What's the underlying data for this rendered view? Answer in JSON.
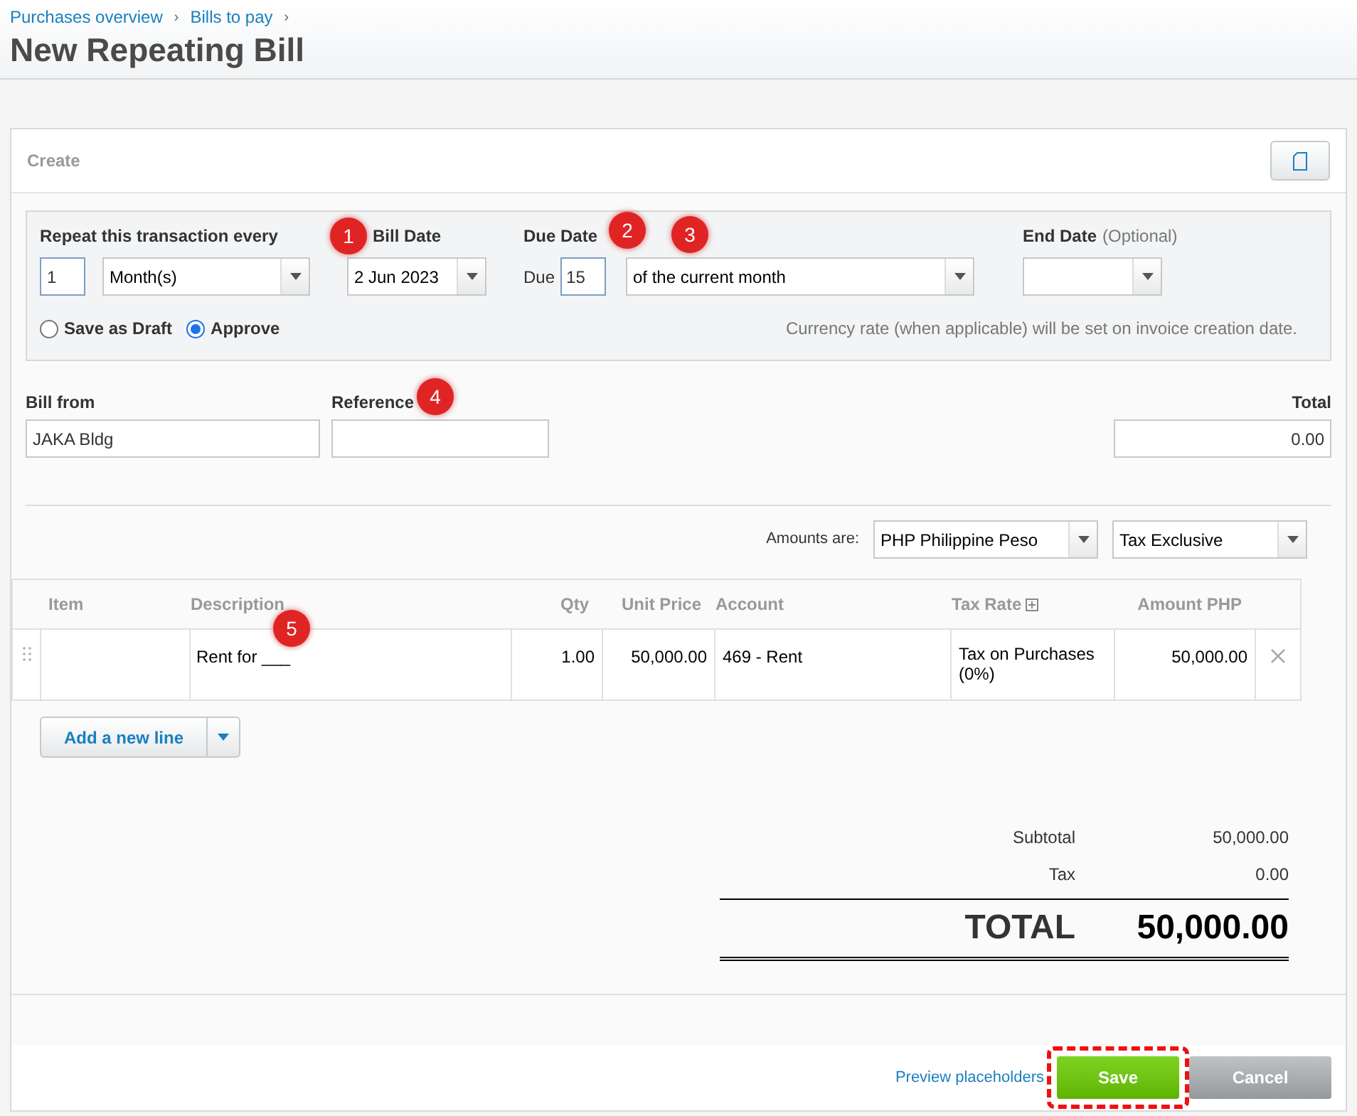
{
  "breadcrumbs": [
    {
      "label": "Purchases overview",
      "separator": "›"
    },
    {
      "label": "Bills to pay",
      "separator": "›"
    }
  ],
  "title": "New Repeating Bill",
  "panel": {
    "title": "Create"
  },
  "schedule": {
    "repeat_label": "Repeat this transaction every",
    "repeat_every": "1",
    "period": "Month(s)",
    "bill_date_label": "Bill Date",
    "bill_date_marker": "1",
    "bill_date": "2 Jun 2023",
    "due_date_label": "Due Date",
    "due_prefix": "Due",
    "due_day_marker": "2",
    "due_day": "15",
    "due_option_marker": "3",
    "due_option": "of the current month",
    "end_date_label": "End Date",
    "end_date_hint": "(Optional)",
    "status_options": [
      {
        "label": "Save as Draft",
        "selected": false
      },
      {
        "label": "Approve",
        "selected": true
      }
    ],
    "note": "Currency rate (when applicable) will be set on invoice creation date."
  },
  "bill_from": {
    "label": "Bill from",
    "value": "JAKA Bldg"
  },
  "reference": {
    "label": "Reference",
    "marker": "4"
  },
  "total_field": {
    "label": "Total",
    "value": "0.00"
  },
  "amounts": {
    "label": "Amounts are:",
    "currency": "PHP Philippine Peso",
    "tax_mode": "Tax Exclusive"
  },
  "table": {
    "columns": [
      {
        "label": "Item",
        "expandable": false
      },
      {
        "label": "Description",
        "expandable": false
      },
      {
        "label": "Qty",
        "expandable": false
      },
      {
        "label": "Unit Price",
        "expandable": false
      },
      {
        "label": "Account",
        "expandable": false
      },
      {
        "label": "Tax Rate",
        "expandable": true
      },
      {
        "label": "Amount PHP",
        "expandable": false
      }
    ],
    "description_marker": "5",
    "rows": [
      {
        "description": "Rent for ___",
        "qty": "1.00",
        "unit_price": "50,000.00",
        "account": "469 - Rent",
        "tax_rate": "Tax on Purchases (0%)",
        "amount": "50,000.00"
      }
    ]
  },
  "add_line": "Add a new line",
  "summary": {
    "subtotal_label": "Subtotal",
    "subtotal": "50,000.00",
    "tax_label": "Tax",
    "tax": "0.00",
    "total_label": "TOTAL",
    "total": "50,000.00"
  },
  "footer": {
    "preview_link": "Preview placeholders",
    "save": "Save",
    "cancel": "Cancel",
    "save_highlighted": true
  }
}
